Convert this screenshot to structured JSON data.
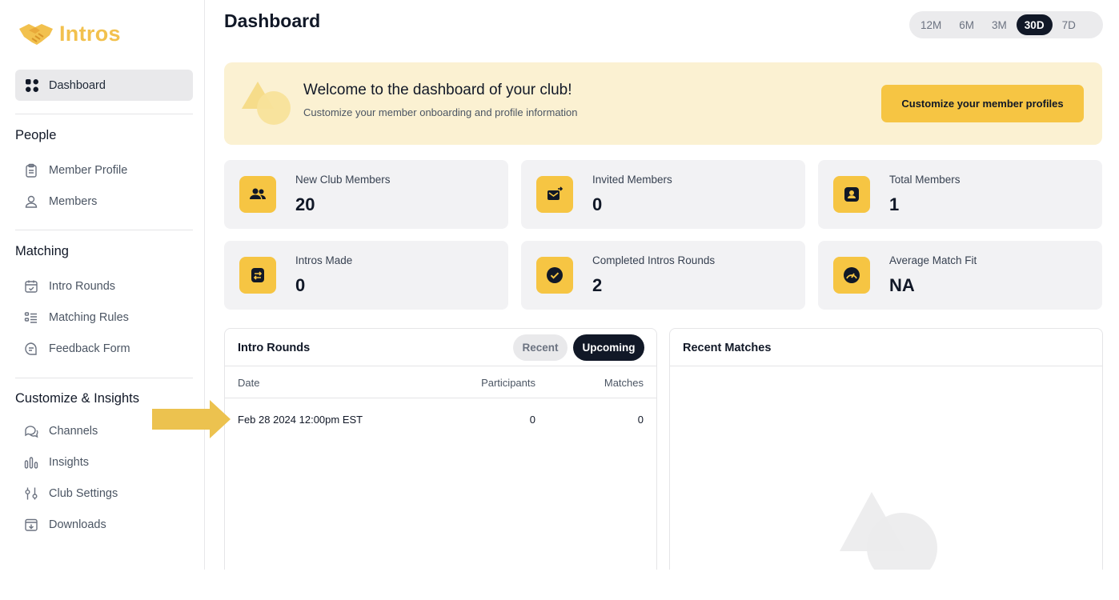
{
  "app": {
    "logo_text": "Intros"
  },
  "sidebar": {
    "active_item": {
      "label": "Dashboard",
      "icon": "grid-icon"
    },
    "sections": [
      {
        "title": "People",
        "items": [
          {
            "label": "Member Profile",
            "icon": "clipboard-icon"
          },
          {
            "label": "Members",
            "icon": "users-icon"
          }
        ]
      },
      {
        "title": "Matching",
        "items": [
          {
            "label": "Intro Rounds",
            "icon": "calendar-check-icon"
          },
          {
            "label": "Matching Rules",
            "icon": "list-icon"
          },
          {
            "label": "Feedback Form",
            "icon": "message-icon"
          }
        ]
      },
      {
        "title": "Customize & Insights",
        "items": [
          {
            "label": "Channels",
            "icon": "chat-bubbles-icon"
          },
          {
            "label": "Insights",
            "icon": "bar-chart-icon"
          },
          {
            "label": "Club Settings",
            "icon": "sliders-icon"
          },
          {
            "label": "Downloads",
            "icon": "download-box-icon"
          }
        ]
      }
    ]
  },
  "header": {
    "title": "Dashboard",
    "ranges": [
      "12M",
      "6M",
      "3M",
      "30D",
      "7D"
    ],
    "selected_range": "30D"
  },
  "banner": {
    "title": "Welcome to the dashboard of your club!",
    "subtitle": "Customize your member onboarding and profile information",
    "button": "Customize your member profiles"
  },
  "stats": [
    {
      "label": "New Club Members",
      "value": "20",
      "icon": "users-icon"
    },
    {
      "label": "Invited Members",
      "value": "0",
      "icon": "mail-send-icon"
    },
    {
      "label": "Total Members",
      "value": "1",
      "icon": "id-badge-icon"
    },
    {
      "label": "Intros Made",
      "value": "0",
      "icon": "swap-icon"
    },
    {
      "label": "Completed Intros Rounds",
      "value": "2",
      "icon": "check-circle-icon"
    },
    {
      "label": "Average Match Fit",
      "value": "NA",
      "icon": "gauge-icon"
    }
  ],
  "intro_rounds": {
    "title": "Intro Rounds",
    "tabs": [
      "Recent",
      "Upcoming"
    ],
    "selected_tab": "Upcoming",
    "columns": [
      "Date",
      "Participants",
      "Matches"
    ],
    "rows": [
      {
        "date": "Feb 28 2024 12:00pm EST",
        "participants": "0",
        "matches": "0"
      }
    ]
  },
  "recent_matches": {
    "title": "Recent Matches"
  },
  "colors": {
    "accent": "#f6c543",
    "banner_bg": "#fbf1d2",
    "dark": "#111827",
    "card_bg": "#f2f2f4"
  }
}
